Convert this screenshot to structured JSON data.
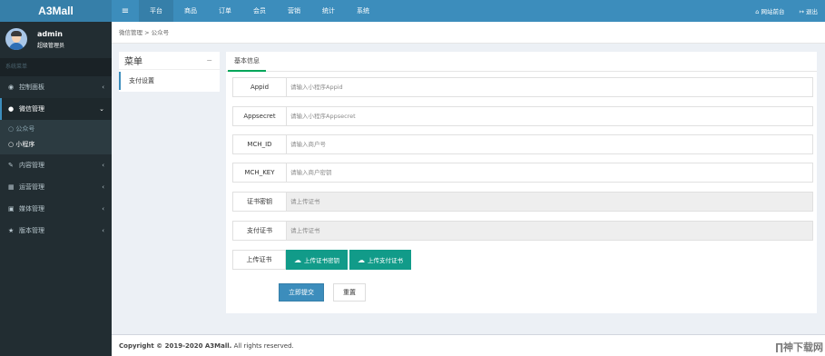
{
  "app": {
    "name": "A3Mall"
  },
  "user": {
    "name": "admin",
    "role": "超级管理员"
  },
  "sidebar": {
    "header": "系统菜单",
    "items": [
      {
        "label": "控制面板",
        "icon": "dashboard-icon",
        "arrow": "‹"
      },
      {
        "label": "微信管理",
        "icon": "wechat-icon",
        "arrow": "⌄"
      },
      {
        "label": "内容管理",
        "icon": "edit-icon",
        "arrow": "‹"
      },
      {
        "label": "运营管理",
        "icon": "operations-icon",
        "arrow": "‹"
      },
      {
        "label": "媒体管理",
        "icon": "image-icon",
        "arrow": "‹"
      },
      {
        "label": "版本管理",
        "icon": "star-icon",
        "arrow": "‹"
      }
    ],
    "sub_items": [
      {
        "label": "公众号",
        "prefix": "○"
      },
      {
        "label": "小程序",
        "prefix": "○"
      }
    ]
  },
  "topbar": {
    "tabs": [
      "平台",
      "商品",
      "订单",
      "会员",
      "营销",
      "统计",
      "系统"
    ],
    "front_link": "网站前台",
    "logout": "退出"
  },
  "breadcrumb": "微信管理 > 公众号",
  "menu_panel": {
    "title": "菜单",
    "item": "支付设置"
  },
  "tab": "基本信息",
  "form": {
    "rows": [
      {
        "label": "Appid",
        "placeholder": "请输入小程序Appid"
      },
      {
        "label": "Appsecret",
        "placeholder": "请输入小程序Appsecret"
      },
      {
        "label": "MCH_ID",
        "placeholder": "请输入商户号"
      },
      {
        "label": "MCH_KEY",
        "placeholder": "请输入商户密钥"
      },
      {
        "label": "证书密钥",
        "placeholder": "请上传证书"
      },
      {
        "label": "支付证书",
        "placeholder": "请上传证书"
      }
    ],
    "upload_label": "上传证书",
    "upload_key_button": "上传证书密钥",
    "upload_cert_button": "上传支付证书",
    "submit": "立即提交",
    "reset": "重置"
  },
  "footer": {
    "copyright": "Copyright © 2019-2020 A3Mall.",
    "rights": " All rights reserved."
  },
  "watermark": "∏神下载网",
  "colors": {
    "topbar": "#3c8dbc",
    "sidebar": "#222d32",
    "upload_button": "#119b89",
    "tab_active": "#00a65a"
  }
}
